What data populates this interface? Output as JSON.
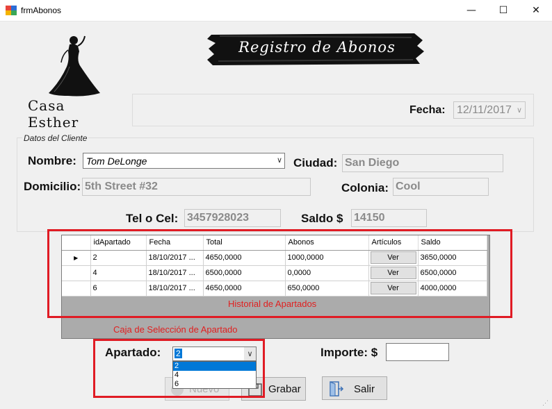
{
  "window": {
    "title": "frmAbonos",
    "min_glyph": "—",
    "max_glyph": "☐",
    "close_glyph": "✕"
  },
  "logo": {
    "text": "Casa   Esther"
  },
  "banner": {
    "text": "Registro de Abonos"
  },
  "fecha": {
    "label": "Fecha:",
    "value": "12/11/2017"
  },
  "cliente": {
    "legend": "Datos del Cliente",
    "nombre_label": "Nombre:",
    "nombre_value": "Tom DeLonge",
    "ciudad_label": "Ciudad:",
    "ciudad_value": "San Diego",
    "domicilio_label": "Domicilio:",
    "domicilio_value": "5th Street #32",
    "colonia_label": "Colonia:",
    "colonia_value": "Cool",
    "tel_label": "Tel o Cel:",
    "tel_value": "3457928023",
    "saldo_label": "Saldo $",
    "saldo_value": "14150"
  },
  "grid": {
    "columns": [
      "idApartado",
      "Fecha",
      "Total",
      "Abonos",
      "Artículos",
      "Saldo"
    ],
    "rows": [
      {
        "id": "2",
        "fecha": "18/10/2017 ...",
        "total": "4650,0000",
        "abonos": "1000,0000",
        "articulos": "Ver",
        "saldo": "3650,0000"
      },
      {
        "id": "4",
        "fecha": "18/10/2017 ...",
        "total": "6500,0000",
        "abonos": "0,0000",
        "articulos": "Ver",
        "saldo": "6500,0000"
      },
      {
        "id": "6",
        "fecha": "18/10/2017 ...",
        "total": "4650,0000",
        "abonos": "650,0000",
        "articulos": "Ver",
        "saldo": "4000,0000"
      }
    ],
    "current_row_glyph": "▶"
  },
  "annotations": {
    "grid_caption": "Historial de Apartados",
    "selection_caption": "Caja de Selección de Apartado"
  },
  "apartado": {
    "label": "Apartado:",
    "value": "2",
    "options": [
      "2",
      "4",
      "6"
    ]
  },
  "importe": {
    "label": "Importe: $",
    "value": ""
  },
  "buttons": {
    "nuevo": "Nuevo",
    "grabar": "Grabar",
    "salir": "Salir"
  },
  "colors": {
    "annotation_red": "#e01b24",
    "selection_blue": "#0078d7",
    "grid_background": "#ababab"
  }
}
